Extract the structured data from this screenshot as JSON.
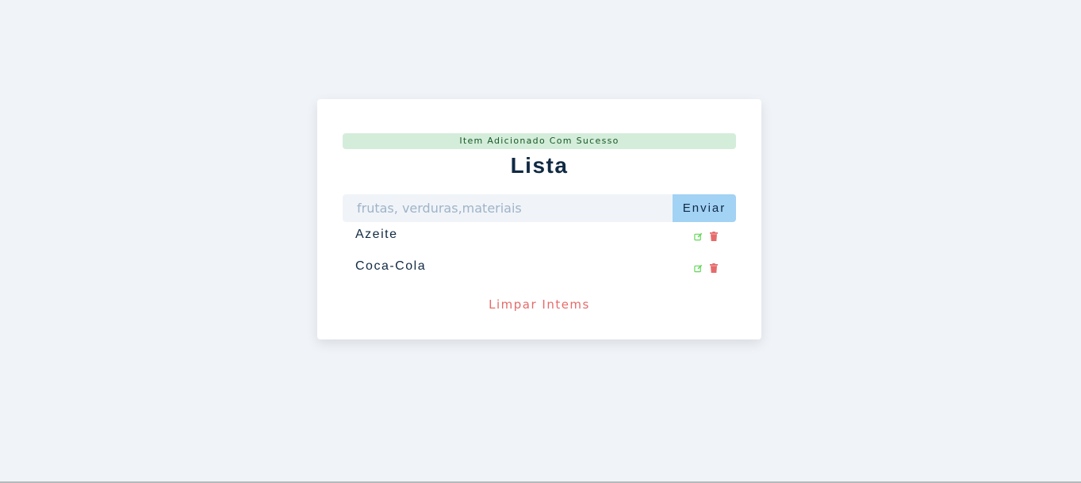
{
  "alert": {
    "text": "Item Adicionado Com Sucesso"
  },
  "title": "Lista",
  "form": {
    "placeholder": "frutas, verduras,materiais",
    "value": "",
    "submit_label": "Enviar"
  },
  "items": [
    {
      "title": "Azeite",
      "edit_icon": "edit-icon",
      "delete_icon": "trash-icon"
    },
    {
      "title": "Coca-Cola",
      "edit_icon": "edit-icon",
      "delete_icon": "trash-icon"
    }
  ],
  "clear_label": "Limpar Intems",
  "colors": {
    "background": "#f0f4f8",
    "alert_bg": "#d4edda",
    "alert_text": "#155724",
    "title": "#102a43",
    "submit_bg": "#a2d2f4",
    "edit_icon": "#65d65a",
    "delete_icon": "#e66a6a",
    "clear_text": "#e66a6a"
  }
}
